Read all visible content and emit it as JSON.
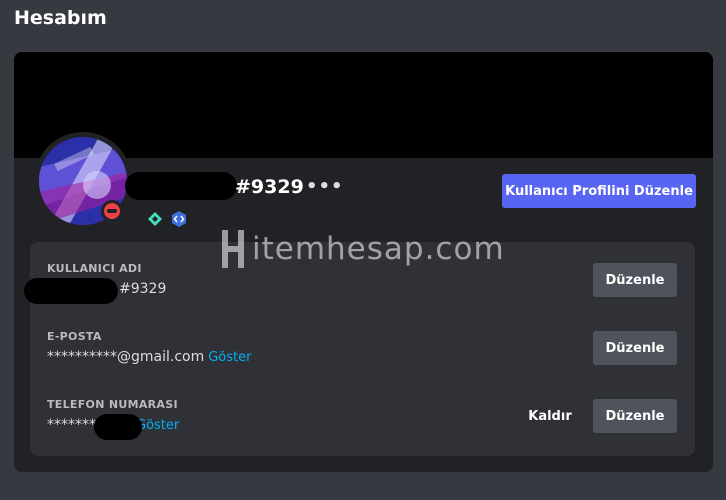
{
  "page": {
    "title": "Hesabım"
  },
  "profile": {
    "username_suffix": "#9329",
    "more_icon": "•••",
    "edit_profile_label": "Kullanıcı Profilini Düzenle",
    "status": "dnd",
    "colors": {
      "accent": "#5865f2",
      "status_dnd": "#ed4245",
      "link": "#00aff4"
    }
  },
  "fields": [
    {
      "label": "KULLANICI ADI",
      "value": "#9329",
      "reveal": "",
      "edit": "Düzenle"
    },
    {
      "label": "E-POSTA",
      "value": "**********@gmail.com",
      "reveal": "Göster",
      "edit": "Düzenle"
    },
    {
      "label": "TELEFON NUMARASI",
      "value": "*******",
      "reveal": "Göster",
      "edit": "Düzenle",
      "remove": "Kaldır"
    }
  ],
  "watermark": {
    "text": "itemhesap.com"
  },
  "badges": [
    "hypesquad-badge-icon",
    "active-developer-badge-icon"
  ]
}
